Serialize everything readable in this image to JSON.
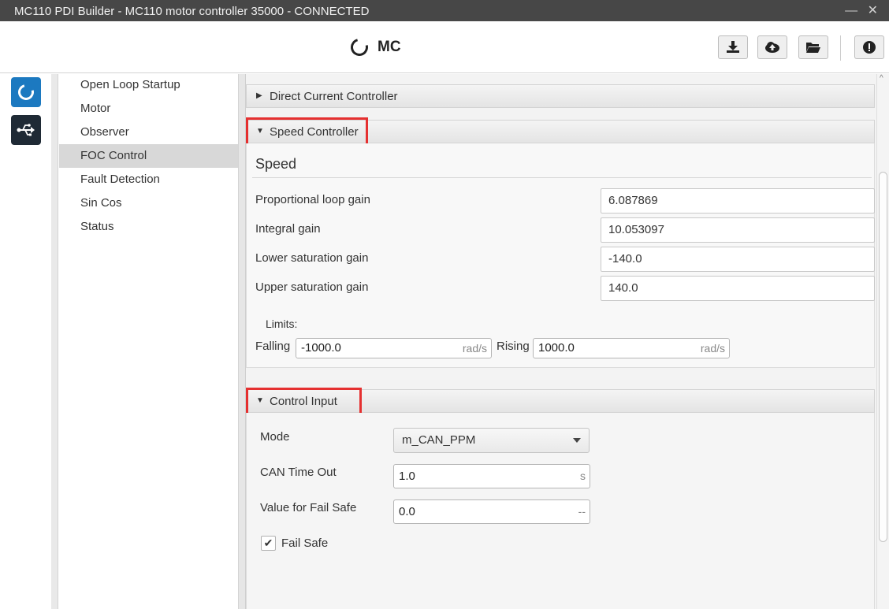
{
  "window": {
    "title": "MC110 PDI Builder - MC110 motor controller 35000 - CONNECTED",
    "controls": "— ✕"
  },
  "header": {
    "brand": "MC",
    "buttons": [
      "download-icon",
      "cloud-upload-icon",
      "folder-open-icon",
      "alert-icon"
    ]
  },
  "sidebar": {
    "icons": [
      "mc-ring-icon",
      "usb-icon"
    ]
  },
  "nav": {
    "items": [
      {
        "label": "Open Loop Startup"
      },
      {
        "label": "Motor"
      },
      {
        "label": "Observer"
      },
      {
        "label": "FOC Control",
        "selected": true
      },
      {
        "label": "Fault Detection"
      },
      {
        "label": "Sin Cos"
      },
      {
        "label": "Status"
      }
    ]
  },
  "sections": {
    "direct_current": {
      "label": "Direct Current Controller",
      "expanded": false
    },
    "speed": {
      "label": "Speed Controller",
      "expanded": true,
      "subheading": "Speed",
      "fields": [
        {
          "label": "Proportional loop gain",
          "value": "6.087869"
        },
        {
          "label": "Integral gain",
          "value": "10.053097"
        },
        {
          "label": "Lower saturation gain",
          "value": "-140.0"
        },
        {
          "label": "Upper saturation gain",
          "value": "140.0"
        }
      ],
      "limits": {
        "label": "Limits:",
        "falling_label": "Falling",
        "falling_value": "-1000.0",
        "falling_unit": "rad/s",
        "rising_label": "Rising",
        "rising_value": "1000.0",
        "rising_unit": "rad/s"
      }
    },
    "control_input": {
      "label": "Control Input",
      "expanded": true,
      "mode_label": "Mode",
      "mode_value": "m_CAN_PPM",
      "timeout_label": "CAN Time Out",
      "timeout_value": "1.0",
      "timeout_unit": "s",
      "failsafe_value_label": "Value for Fail Safe",
      "failsafe_value": "0.0",
      "failsafe_unit": "--",
      "failsafe_checkbox_label": "Fail Safe",
      "failsafe_checked": true
    }
  },
  "colors": {
    "titlebar": "#474747",
    "highlight_box": "#e53030",
    "accent_blue": "#1c79c0"
  }
}
